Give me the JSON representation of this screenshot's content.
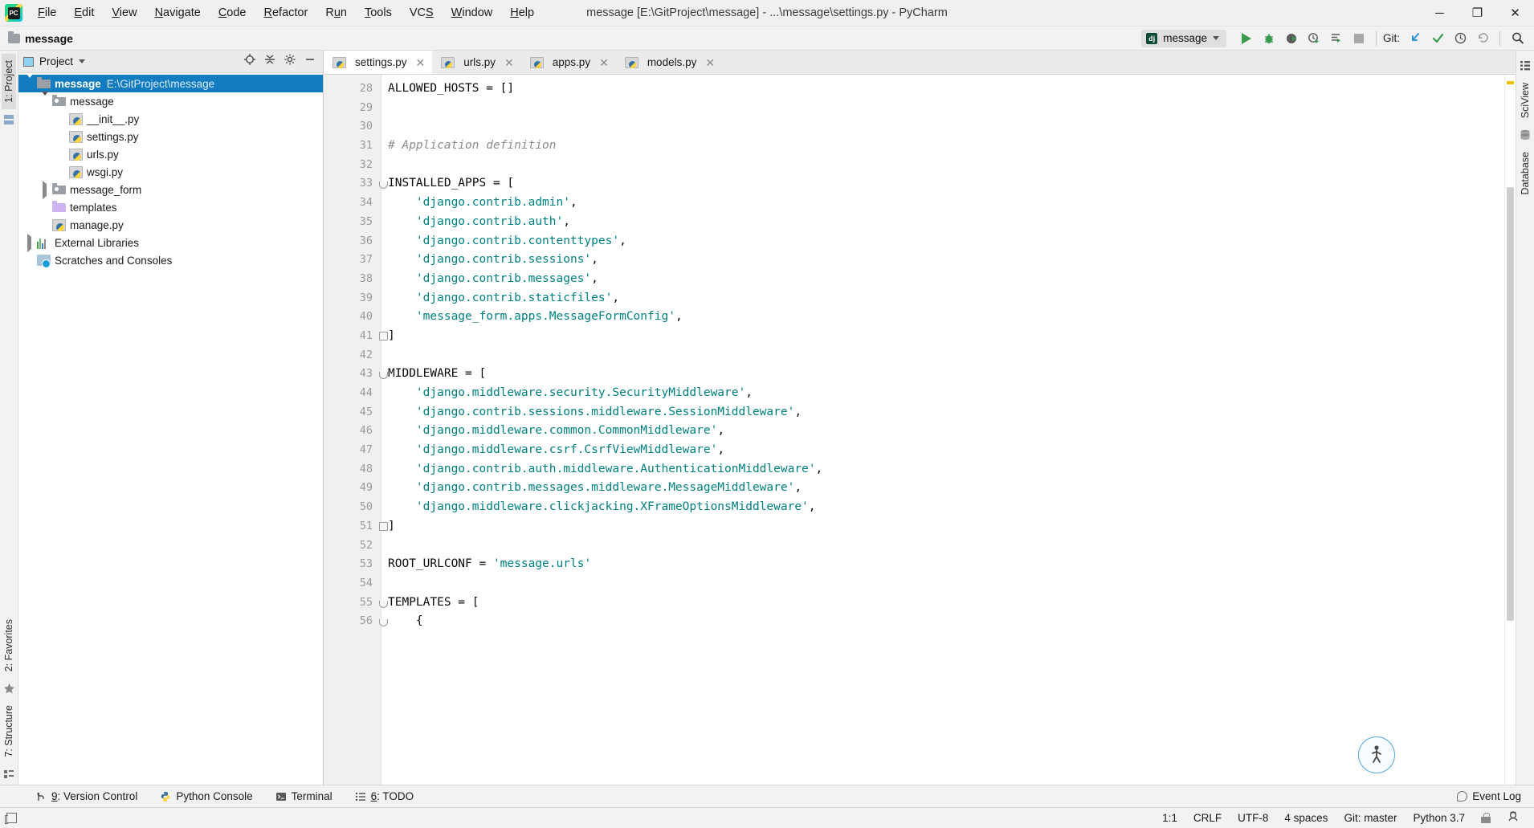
{
  "window": {
    "title": "message [E:\\GitProject\\message] - ...\\message\\settings.py - PyCharm",
    "minimize": "─",
    "maximize": "❐",
    "close": "✕"
  },
  "menubar": {
    "items": [
      {
        "label": "File",
        "mnemonic": "F"
      },
      {
        "label": "Edit",
        "mnemonic": "E"
      },
      {
        "label": "View",
        "mnemonic": "V"
      },
      {
        "label": "Navigate",
        "mnemonic": "N"
      },
      {
        "label": "Code",
        "mnemonic": "C"
      },
      {
        "label": "Refactor",
        "mnemonic": "R"
      },
      {
        "label": "Run",
        "mnemonic": "u"
      },
      {
        "label": "Tools",
        "mnemonic": "T"
      },
      {
        "label": "VCS",
        "mnemonic": "S"
      },
      {
        "label": "Window",
        "mnemonic": "W"
      },
      {
        "label": "Help",
        "mnemonic": "H"
      }
    ]
  },
  "navbar": {
    "breadcrumb": "message",
    "run_config": "message",
    "run_config_icon": "django-icon",
    "git_label": "Git:",
    "icons": [
      "run-icon",
      "debug-icon",
      "coverage-icon",
      "profile-icon",
      "run-with-console-icon",
      "stop-icon",
      "update-project-icon",
      "commit-icon",
      "history-icon",
      "rollback-icon",
      "search-everywhere-icon"
    ]
  },
  "left_strip": {
    "top_tab": "1: Project",
    "bottom_tabs": [
      "2: Favorites",
      "7: Structure"
    ]
  },
  "right_strip": {
    "tabs": [
      "SciView",
      "Database"
    ]
  },
  "project_panel": {
    "title": "Project",
    "actions": [
      "locate-icon",
      "collapse-all-icon",
      "settings-icon",
      "hide-icon"
    ],
    "tree": [
      {
        "label": "message",
        "path": "E:\\GitProject\\message",
        "icon": "folder-icon",
        "indent": 0,
        "twisty": "down",
        "selected": true,
        "bold": true
      },
      {
        "label": "message",
        "path": "",
        "icon": "package-folder-icon",
        "indent": 1,
        "twisty": "down",
        "selected": false,
        "bold": false
      },
      {
        "label": "__init__.py",
        "path": "",
        "icon": "python-file-icon",
        "indent": 2,
        "twisty": "none",
        "selected": false,
        "bold": false
      },
      {
        "label": "settings.py",
        "path": "",
        "icon": "python-file-icon",
        "indent": 2,
        "twisty": "none",
        "selected": false,
        "bold": false
      },
      {
        "label": "urls.py",
        "path": "",
        "icon": "python-file-icon",
        "indent": 2,
        "twisty": "none",
        "selected": false,
        "bold": false
      },
      {
        "label": "wsgi.py",
        "path": "",
        "icon": "python-file-icon",
        "indent": 2,
        "twisty": "none",
        "selected": false,
        "bold": false
      },
      {
        "label": "message_form",
        "path": "",
        "icon": "package-folder-icon",
        "indent": 1,
        "twisty": "right",
        "selected": false,
        "bold": false
      },
      {
        "label": "templates",
        "path": "",
        "icon": "templates-folder-icon",
        "indent": 1,
        "twisty": "none",
        "selected": false,
        "bold": false
      },
      {
        "label": "manage.py",
        "path": "",
        "icon": "python-file-icon",
        "indent": 1,
        "twisty": "none",
        "selected": false,
        "bold": false
      },
      {
        "label": "External Libraries",
        "path": "",
        "icon": "libraries-icon",
        "indent": 0,
        "twisty": "right",
        "selected": false,
        "bold": false
      },
      {
        "label": "Scratches and Consoles",
        "path": "",
        "icon": "scratches-icon",
        "indent": 0,
        "twisty": "none",
        "selected": false,
        "bold": false
      }
    ]
  },
  "editor": {
    "tabs": [
      {
        "label": "settings.py",
        "active": true
      },
      {
        "label": "urls.py",
        "active": false
      },
      {
        "label": "apps.py",
        "active": false
      },
      {
        "label": "models.py",
        "active": false
      }
    ],
    "first_line_number": 28,
    "lines": [
      {
        "n": 28,
        "fold": "none",
        "tokens": [
          {
            "t": "ALLOWED_HOSTS = []",
            "c": "s-pun"
          }
        ]
      },
      {
        "n": 29,
        "fold": "none",
        "tokens": [
          {
            "t": "",
            "c": "s-pun"
          }
        ]
      },
      {
        "n": 30,
        "fold": "none",
        "tokens": [
          {
            "t": "",
            "c": "s-pun"
          }
        ]
      },
      {
        "n": 31,
        "fold": "none",
        "tokens": [
          {
            "t": "# Application definition",
            "c": "s-com"
          }
        ]
      },
      {
        "n": 32,
        "fold": "none",
        "tokens": [
          {
            "t": "",
            "c": "s-pun"
          }
        ]
      },
      {
        "n": 33,
        "fold": "open",
        "tokens": [
          {
            "t": "INSTALLED_APPS = [",
            "c": "s-pun"
          }
        ]
      },
      {
        "n": 34,
        "fold": "none",
        "tokens": [
          {
            "t": "    ",
            "c": "s-pun"
          },
          {
            "t": "'django.contrib.admin'",
            "c": "s-str"
          },
          {
            "t": ",",
            "c": "s-pun"
          }
        ]
      },
      {
        "n": 35,
        "fold": "none",
        "tokens": [
          {
            "t": "    ",
            "c": "s-pun"
          },
          {
            "t": "'django.contrib.auth'",
            "c": "s-str"
          },
          {
            "t": ",",
            "c": "s-pun"
          }
        ]
      },
      {
        "n": 36,
        "fold": "none",
        "tokens": [
          {
            "t": "    ",
            "c": "s-pun"
          },
          {
            "t": "'django.contrib.contenttypes'",
            "c": "s-str"
          },
          {
            "t": ",",
            "c": "s-pun"
          }
        ]
      },
      {
        "n": 37,
        "fold": "none",
        "tokens": [
          {
            "t": "    ",
            "c": "s-pun"
          },
          {
            "t": "'django.contrib.sessions'",
            "c": "s-str"
          },
          {
            "t": ",",
            "c": "s-pun"
          }
        ]
      },
      {
        "n": 38,
        "fold": "none",
        "tokens": [
          {
            "t": "    ",
            "c": "s-pun"
          },
          {
            "t": "'django.contrib.messages'",
            "c": "s-str"
          },
          {
            "t": ",",
            "c": "s-pun"
          }
        ]
      },
      {
        "n": 39,
        "fold": "none",
        "tokens": [
          {
            "t": "    ",
            "c": "s-pun"
          },
          {
            "t": "'django.contrib.staticfiles'",
            "c": "s-str"
          },
          {
            "t": ",",
            "c": "s-pun"
          }
        ]
      },
      {
        "n": 40,
        "fold": "none",
        "tokens": [
          {
            "t": "    ",
            "c": "s-pun"
          },
          {
            "t": "'message_form.apps.MessageFormConfig'",
            "c": "s-str"
          },
          {
            "t": ",",
            "c": "s-pun"
          }
        ]
      },
      {
        "n": 41,
        "fold": "close",
        "tokens": [
          {
            "t": "]",
            "c": "s-pun"
          }
        ]
      },
      {
        "n": 42,
        "fold": "none",
        "tokens": [
          {
            "t": "",
            "c": "s-pun"
          }
        ]
      },
      {
        "n": 43,
        "fold": "open",
        "tokens": [
          {
            "t": "MIDDLEWARE = [",
            "c": "s-pun"
          }
        ]
      },
      {
        "n": 44,
        "fold": "none",
        "tokens": [
          {
            "t": "    ",
            "c": "s-pun"
          },
          {
            "t": "'django.middleware.security.SecurityMiddleware'",
            "c": "s-str"
          },
          {
            "t": ",",
            "c": "s-pun"
          }
        ]
      },
      {
        "n": 45,
        "fold": "none",
        "tokens": [
          {
            "t": "    ",
            "c": "s-pun"
          },
          {
            "t": "'django.contrib.sessions.middleware.SessionMiddleware'",
            "c": "s-str"
          },
          {
            "t": ",",
            "c": "s-pun"
          }
        ]
      },
      {
        "n": 46,
        "fold": "none",
        "tokens": [
          {
            "t": "    ",
            "c": "s-pun"
          },
          {
            "t": "'django.middleware.common.CommonMiddleware'",
            "c": "s-str"
          },
          {
            "t": ",",
            "c": "s-pun"
          }
        ]
      },
      {
        "n": 47,
        "fold": "none",
        "tokens": [
          {
            "t": "    ",
            "c": "s-pun"
          },
          {
            "t": "'django.middleware.csrf.CsrfViewMiddleware'",
            "c": "s-str"
          },
          {
            "t": ",",
            "c": "s-pun"
          }
        ]
      },
      {
        "n": 48,
        "fold": "none",
        "tokens": [
          {
            "t": "    ",
            "c": "s-pun"
          },
          {
            "t": "'django.contrib.auth.middleware.AuthenticationMiddleware'",
            "c": "s-str"
          },
          {
            "t": ",",
            "c": "s-pun"
          }
        ]
      },
      {
        "n": 49,
        "fold": "none",
        "tokens": [
          {
            "t": "    ",
            "c": "s-pun"
          },
          {
            "t": "'django.contrib.messages.middleware.MessageMiddleware'",
            "c": "s-str"
          },
          {
            "t": ",",
            "c": "s-pun"
          }
        ]
      },
      {
        "n": 50,
        "fold": "none",
        "tokens": [
          {
            "t": "    ",
            "c": "s-pun"
          },
          {
            "t": "'django.middleware.clickjacking.XFrameOptionsMiddleware'",
            "c": "s-str"
          },
          {
            "t": ",",
            "c": "s-pun"
          }
        ]
      },
      {
        "n": 51,
        "fold": "close",
        "tokens": [
          {
            "t": "]",
            "c": "s-pun"
          }
        ]
      },
      {
        "n": 52,
        "fold": "none",
        "tokens": [
          {
            "t": "",
            "c": "s-pun"
          }
        ]
      },
      {
        "n": 53,
        "fold": "none",
        "tokens": [
          {
            "t": "ROOT_URLCONF = ",
            "c": "s-pun"
          },
          {
            "t": "'message.urls'",
            "c": "s-str"
          }
        ]
      },
      {
        "n": 54,
        "fold": "none",
        "tokens": [
          {
            "t": "",
            "c": "s-pun"
          }
        ]
      },
      {
        "n": 55,
        "fold": "open",
        "tokens": [
          {
            "t": "TEMPLATES = [",
            "c": "s-pun"
          }
        ]
      },
      {
        "n": 56,
        "fold": "open",
        "tokens": [
          {
            "t": "    {",
            "c": "s-pun"
          }
        ]
      }
    ],
    "float_widget_icon": "running-man-icon"
  },
  "toolwindows": {
    "items": [
      {
        "num": "9",
        "label": ": Version Control",
        "icon": "branch-icon"
      },
      {
        "num": "",
        "label": "Python Console",
        "icon": "python-icon"
      },
      {
        "num": "",
        "label": "Terminal",
        "icon": "terminal-icon"
      },
      {
        "num": "6",
        "label": ": TODO",
        "icon": "todo-icon"
      }
    ],
    "event_log": "Event Log"
  },
  "statusbar": {
    "caret": "1:1",
    "line_separator": "CRLF",
    "encoding": "UTF-8",
    "indent": "4 spaces",
    "git_branch": "Git: master",
    "interpreter": "Python 3.7"
  },
  "colors": {
    "selection_blue": "#127cc1",
    "string_teal": "#008080",
    "comment_gray": "#8c8c8c",
    "run_green": "#3c9a4e",
    "marker_yellow": "#f0c000"
  }
}
